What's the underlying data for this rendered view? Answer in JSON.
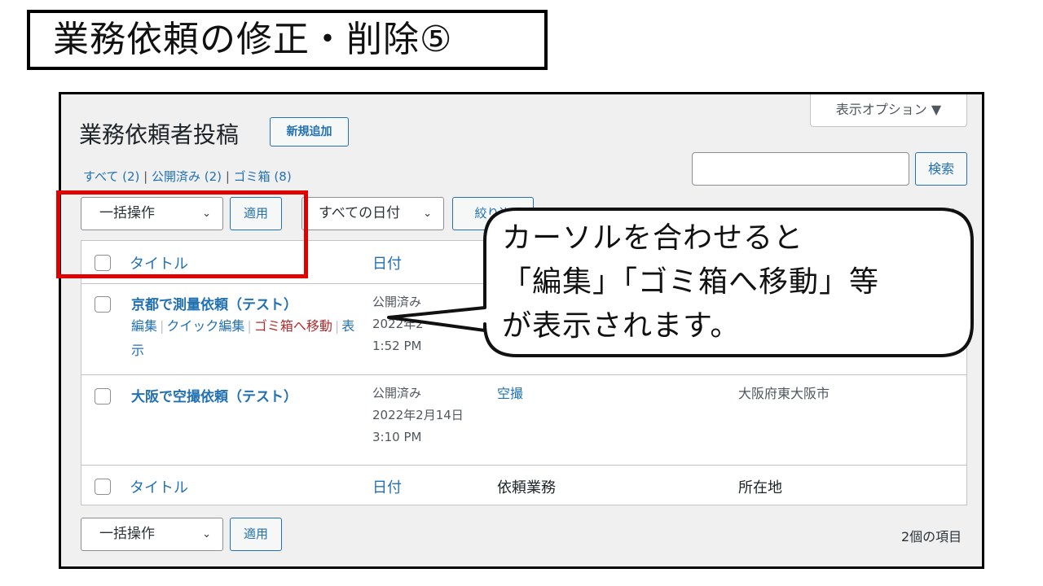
{
  "slide": {
    "title": "業務依頼の修正・削除⑤"
  },
  "screen_options": {
    "label": "表示オプション ▼"
  },
  "page": {
    "heading": "業務依頼者投稿",
    "add_new": "新規追加"
  },
  "filters": {
    "all": "すべて (2)",
    "published": "公開済み (2)",
    "trash": "ゴミ箱 (8)",
    "sep": "|"
  },
  "search": {
    "value": "",
    "button": "検索"
  },
  "toolbar_top": {
    "bulk": "一括操作",
    "apply": "適用",
    "dates": "すべての日付",
    "filter": "絞り込",
    "items": "2個の項目"
  },
  "columns": {
    "title": "タイトル",
    "date": "日付",
    "request_type": "依頼業務",
    "location": "所在地"
  },
  "rows": [
    {
      "title": "京都で測量依頼（テスト）",
      "status": "公開済み",
      "date": "2022年2",
      "time": "1:52 PM",
      "actions": {
        "edit": "編集",
        "quick_edit": "クイック編集",
        "trash": "ゴミ箱へ移動",
        "view": "表示"
      }
    },
    {
      "title": "大阪で空撮依頼（テスト）",
      "status": "公開済み",
      "date": "2022年2月14日",
      "time": "3:10 PM",
      "request_type": "空撮",
      "location": "大阪府東大阪市"
    }
  ],
  "toolbar_bottom": {
    "bulk": "一括操作",
    "apply": "適用",
    "items": "2個の項目"
  },
  "callout": {
    "line1": "カーソルを合わせると",
    "line2": "「編集」「ゴミ箱へ移動」等",
    "line3": "が表示されます。"
  },
  "colors": {
    "link": "#2271b1",
    "trash": "#b32d2e",
    "highlight": "#e00000"
  }
}
